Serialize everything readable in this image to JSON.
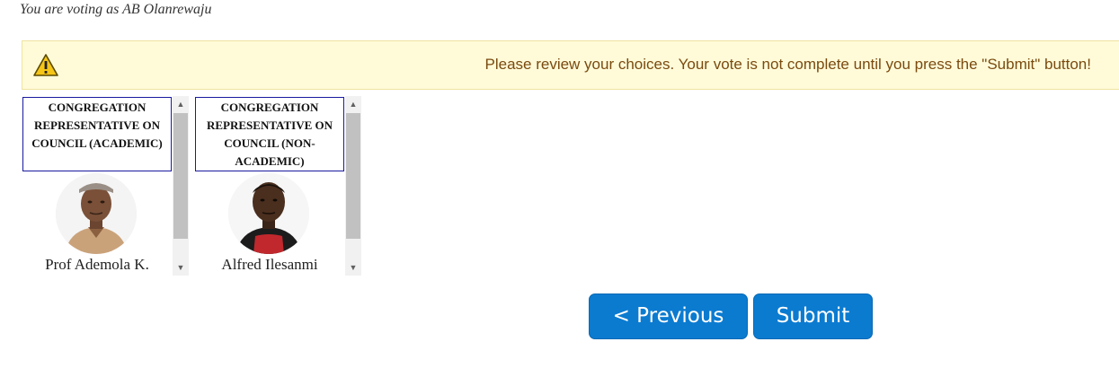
{
  "header": {
    "voting_as": "You are voting as AB Olanrewaju"
  },
  "alert": {
    "icon": "warning-icon",
    "message": "Please review your choices. Your vote is not complete until you press the \"Submit\" button!"
  },
  "ballots": [
    {
      "position": "Congregation Representative on Council (Academic)",
      "candidate": "Prof Ademola K.",
      "photo": "candidate-photo"
    },
    {
      "position": "Congregation Representative on Council (Non-Academic)",
      "candidate": "Alfred Ilesanmi",
      "photo": "candidate-photo"
    }
  ],
  "buttons": {
    "previous": "< Previous",
    "submit": "Submit"
  },
  "colors": {
    "button": "#0b7bd0",
    "alert_bg": "#fffbd9",
    "alert_text": "#7a4a0f",
    "title_border": "#1a1aa0"
  }
}
